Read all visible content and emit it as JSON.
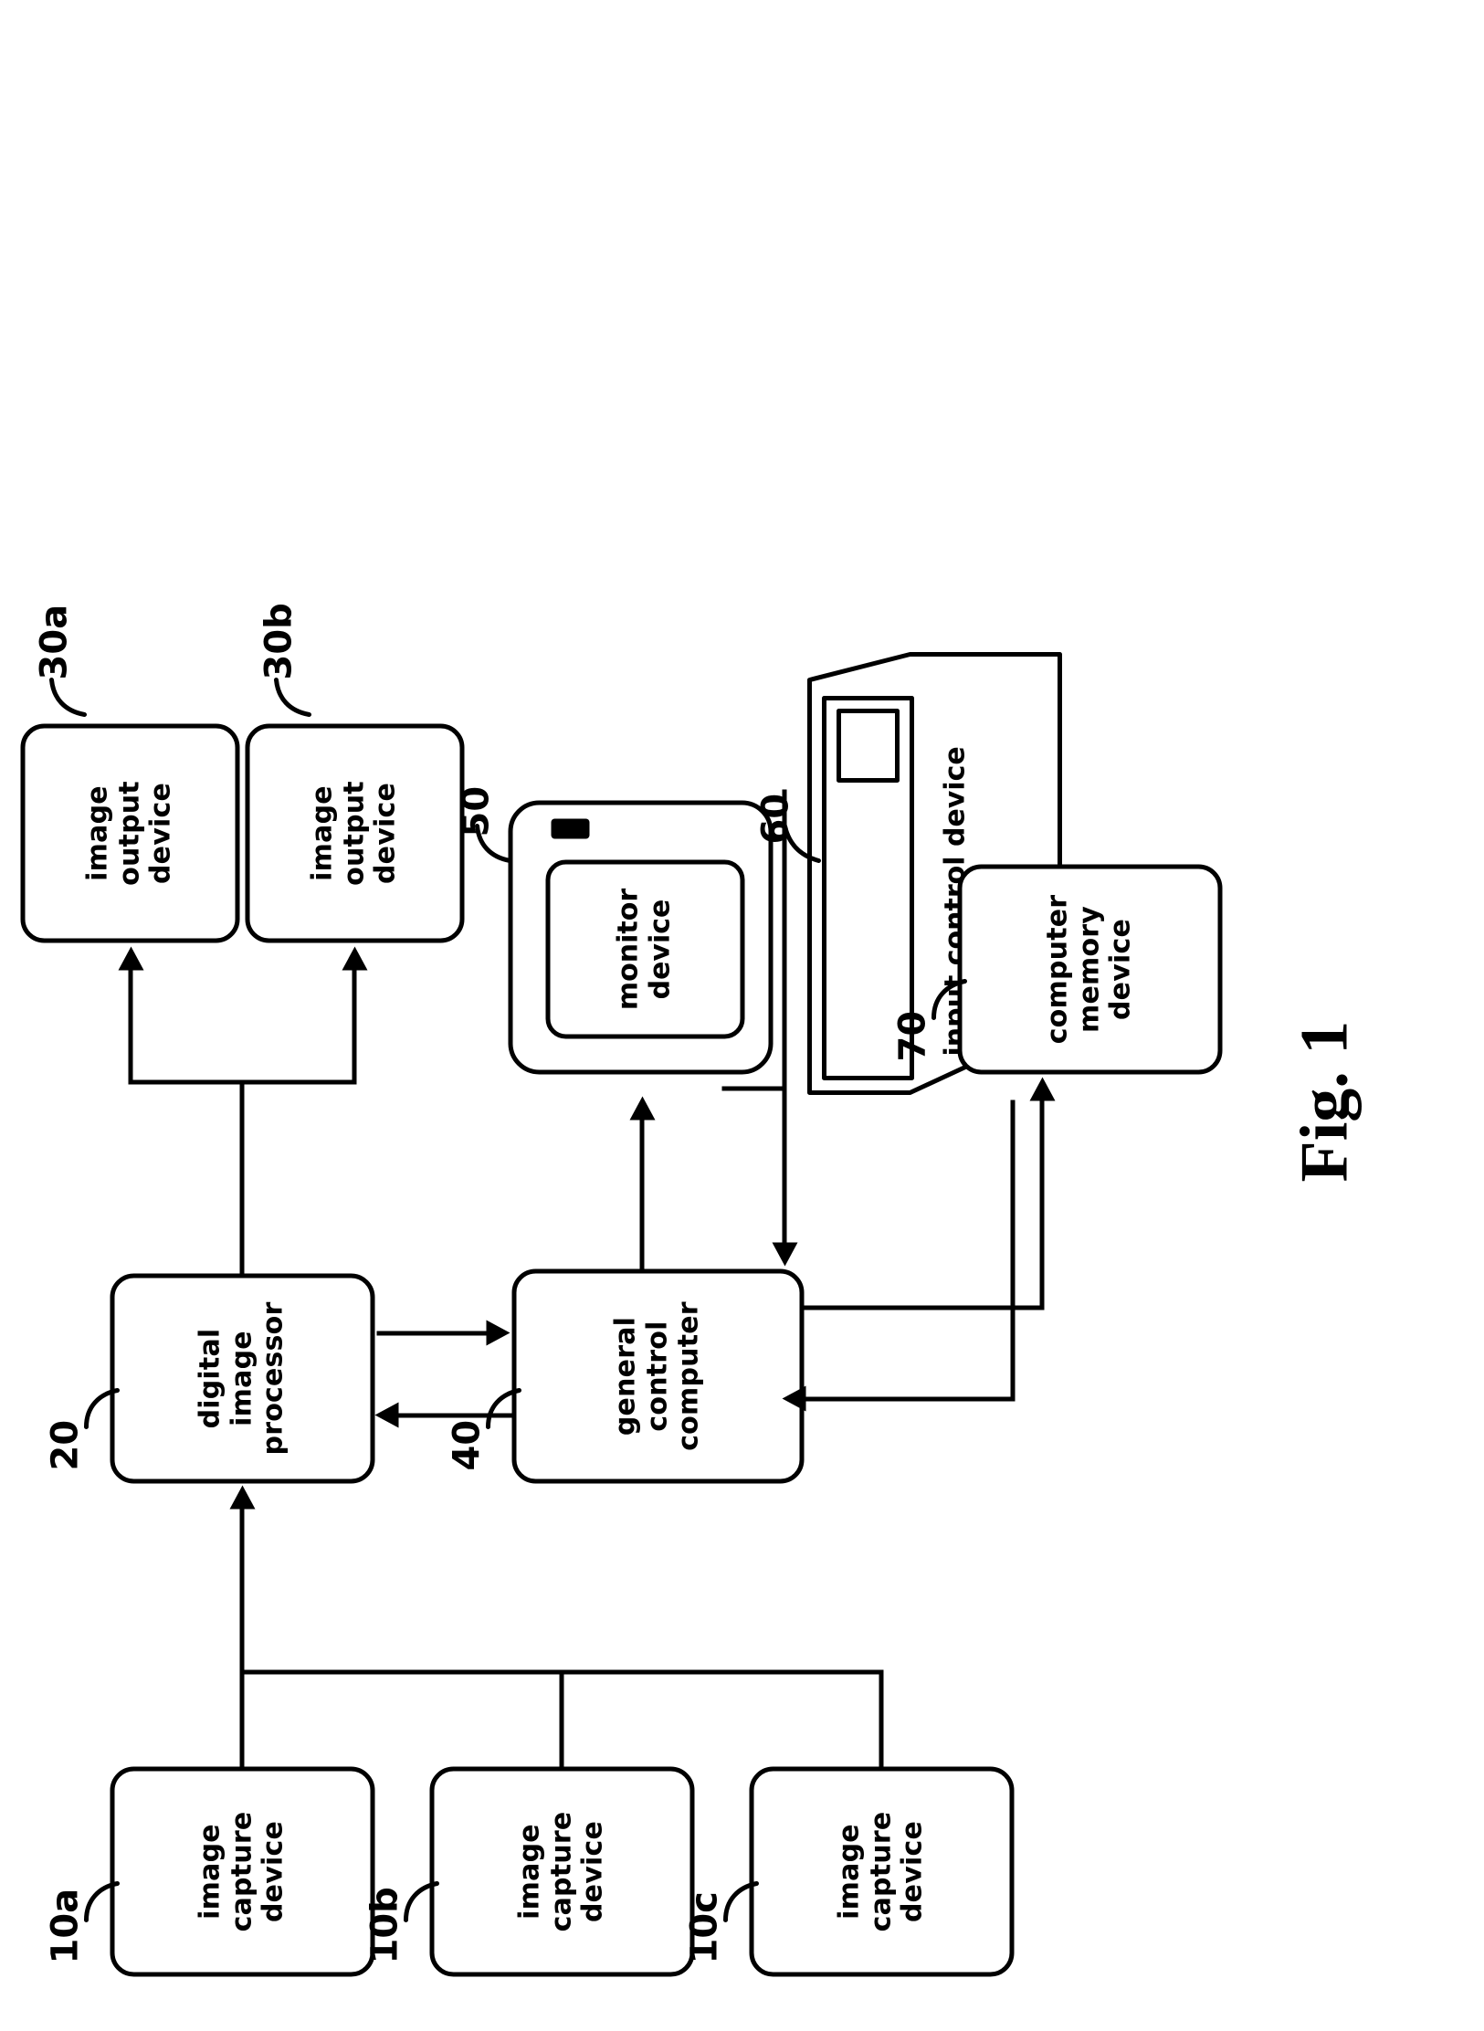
{
  "figure": {
    "caption": "Fig. 1",
    "orientation": "rotated-90-ccw"
  },
  "blocks": {
    "capture_a": {
      "ref": "10a",
      "lines": [
        "image",
        "capture",
        "device"
      ]
    },
    "capture_b": {
      "ref": "10b",
      "lines": [
        "image",
        "capture",
        "device"
      ]
    },
    "capture_c": {
      "ref": "10c",
      "lines": [
        "image",
        "capture",
        "device"
      ]
    },
    "processor": {
      "ref": "20",
      "lines": [
        "digital",
        "image",
        "processor"
      ]
    },
    "output_a": {
      "ref": "30a",
      "lines": [
        "image",
        "output",
        "device"
      ]
    },
    "output_b": {
      "ref": "30b",
      "lines": [
        "image",
        "output",
        "device"
      ]
    },
    "control_computer": {
      "ref": "40",
      "lines": [
        "general",
        "control",
        "computer"
      ]
    },
    "monitor": {
      "ref": "50",
      "lines": [
        "monitor",
        "device"
      ]
    },
    "input_control": {
      "ref": "60",
      "lines": [
        "input control device"
      ]
    },
    "memory": {
      "ref": "70",
      "lines": [
        "computer",
        "memory",
        "device"
      ]
    }
  },
  "connections": [
    {
      "from": "capture_a",
      "to": "processor",
      "arrow": "to"
    },
    {
      "from": "capture_b",
      "to": "processor",
      "arrow": "to"
    },
    {
      "from": "capture_c",
      "to": "processor",
      "arrow": "to"
    },
    {
      "from": "processor",
      "to": "output_a",
      "arrow": "to"
    },
    {
      "from": "processor",
      "to": "output_b",
      "arrow": "to"
    },
    {
      "from": "processor",
      "to": "control_computer",
      "arrow": "both"
    },
    {
      "from": "control_computer",
      "to": "monitor",
      "arrow": "to"
    },
    {
      "from": "input_control",
      "to": "control_computer",
      "arrow": "to"
    },
    {
      "from": "control_computer",
      "to": "memory",
      "arrow": "both"
    }
  ],
  "colors": {
    "ink": "#000000",
    "paper": "#ffffff"
  }
}
